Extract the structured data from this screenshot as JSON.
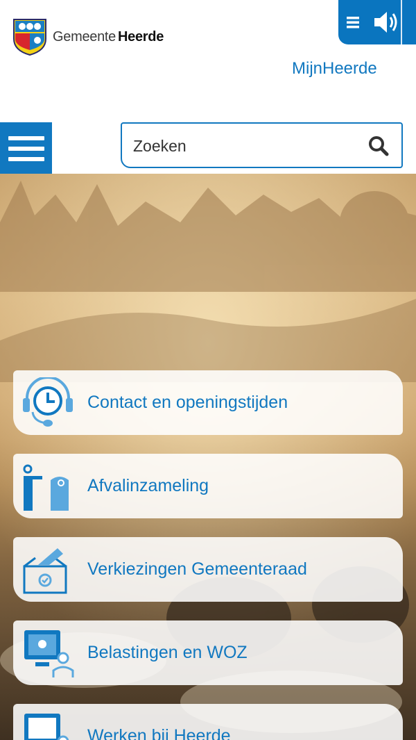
{
  "header": {
    "logo_prefix": "Gemeente",
    "logo_name": "Heerde",
    "mijn_link": "MijnHeerde"
  },
  "search": {
    "placeholder": "Zoeken"
  },
  "tiles": [
    {
      "label": "Contact en openingstijden",
      "icon": "headset-clock-icon"
    },
    {
      "label": "Afvalinzameling",
      "icon": "person-bin-icon"
    },
    {
      "label": "Verkiezingen Gemeenteraad",
      "icon": "ballot-box-icon"
    },
    {
      "label": "Belastingen en WOZ",
      "icon": "monitor-person-icon"
    },
    {
      "label": "Werken bij Heerde",
      "icon": "monitor-person-icon"
    }
  ],
  "colors": {
    "brand_blue": "#1178c0",
    "light_blue": "#5aa8de"
  }
}
